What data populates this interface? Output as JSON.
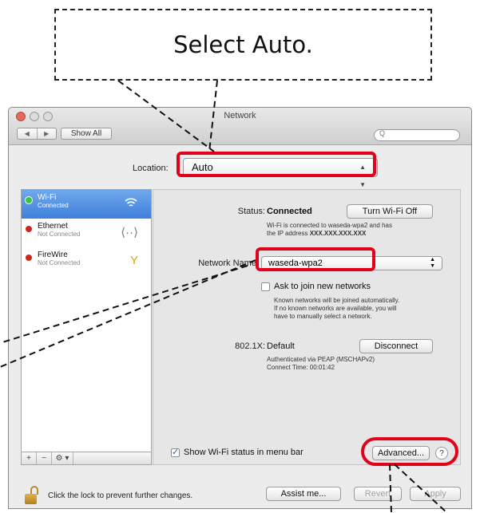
{
  "callout": {
    "text": "Select Auto."
  },
  "window": {
    "title": "Network",
    "nav_back": "◀",
    "nav_forward": "▶",
    "show_all": "Show All",
    "search_icon": "search-icon"
  },
  "location": {
    "label": "Location:",
    "value": "Auto"
  },
  "services": [
    {
      "name": "Wi-Fi",
      "status": "Connected",
      "icon": "wifi-icon",
      "selected": true
    },
    {
      "name": "Ethernet",
      "status": "Not Connected",
      "icon": "ethernet-icon",
      "selected": false
    },
    {
      "name": "FireWire",
      "status": "Not Connected",
      "icon": "firewire-icon",
      "selected": false
    }
  ],
  "sidebar_tools": {
    "add": "+",
    "remove": "−",
    "gear": "⚙ ▾"
  },
  "detail": {
    "status_label": "Status:",
    "status_value": "Connected",
    "turn_off_button": "Turn Wi-Fi Off",
    "status_note_line1": "Wi-Fi is connected to waseda-wpa2 and has",
    "status_note_line2_prefix": "the IP address",
    "status_note_ip": "XXX.XXX.XXX.XXX",
    "network_name_label": "Network Name:",
    "network_name_value": "waseda-wpa2",
    "ask_join_label": "Ask to join new networks",
    "ask_note_line1": "Known networks will be joined automatically.",
    "ask_note_line2": "If no known networks are available, you will",
    "ask_note_line3": "have to manually select a network.",
    "auth_label": "802.1X:",
    "auth_value": "Default",
    "disconnect_button": "Disconnect",
    "auth_note_line1": "Authenticated via PEAP (MSCHAPv2)",
    "auth_note_line2": "Connect Time: 00:01:42",
    "show_status_label": "Show Wi-Fi status in menu bar",
    "advanced_button": "Advanced...",
    "help_button": "?"
  },
  "bottom": {
    "lock_text": "Click the lock to prevent further changes.",
    "assist_button": "Assist me...",
    "revert_button": "Revert",
    "apply_button": "Apply"
  },
  "colors": {
    "highlight": "#e3001b",
    "selection": "#3f7fdc"
  }
}
